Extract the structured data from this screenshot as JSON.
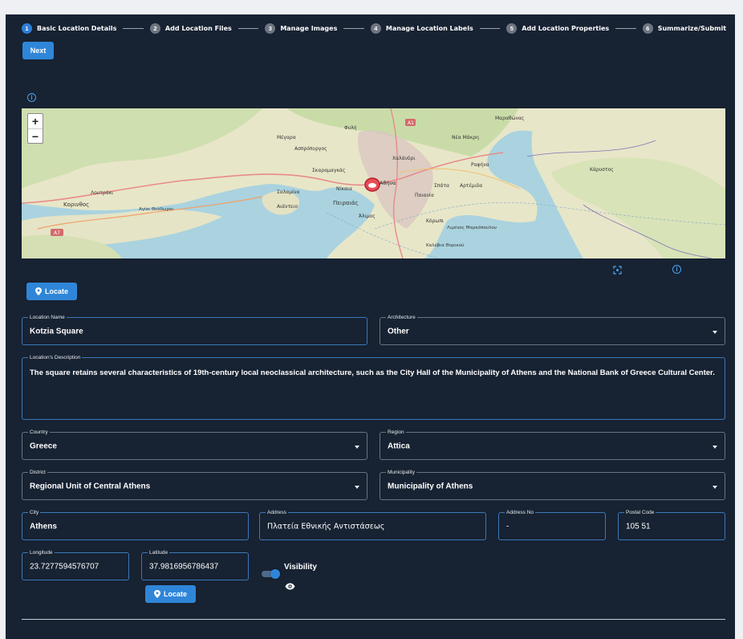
{
  "stepper": {
    "steps": [
      {
        "num": "1",
        "label": "Basic Location Details"
      },
      {
        "num": "2",
        "label": "Add Location Files"
      },
      {
        "num": "3",
        "label": "Manage Images"
      },
      {
        "num": "4",
        "label": "Manage Location Labels"
      },
      {
        "num": "5",
        "label": "Add Location Properties"
      },
      {
        "num": "6",
        "label": "Summarize/Submit"
      }
    ]
  },
  "next_button": "Next",
  "map": {
    "zoom_in": "+",
    "zoom_out": "−",
    "labels": [
      {
        "text": "Μέγαρα"
      },
      {
        "text": "Ασπρόπυργος"
      },
      {
        "text": "Φυλή"
      },
      {
        "text": "Αθήνα"
      },
      {
        "text": "Μαραθώνας"
      },
      {
        "text": "Νέα Μάκρη"
      },
      {
        "text": "Χαλάνδρι"
      },
      {
        "text": "Ραφήνα"
      },
      {
        "text": "Σκαραμαγκάς"
      },
      {
        "text": "Σαλαμίνα"
      },
      {
        "text": "Νίκαια"
      },
      {
        "text": "Πειραιάς"
      },
      {
        "text": "Αιάντειο"
      },
      {
        "text": "Άλιμος"
      },
      {
        "text": "Παιανία"
      },
      {
        "text": "Σπάτα"
      },
      {
        "text": "Αρτέμιδα"
      },
      {
        "text": "Κόρωπι"
      },
      {
        "text": "Κορινθος"
      },
      {
        "text": "Λουτράκι"
      },
      {
        "text": "Κάρυστος"
      },
      {
        "text": "Αγίοι Θεόδωροι"
      },
      {
        "text": "Λιμένας Μαρκόπουλου"
      },
      {
        "text": "Καλύβια Θορικού"
      },
      {
        "text": "A7"
      },
      {
        "text": "A1"
      }
    ]
  },
  "locate_button": "Locate",
  "fields": {
    "location_name": {
      "label": "Location Name",
      "value": "Kotzia Square"
    },
    "architecture": {
      "label": "Architecture",
      "value": "Other"
    },
    "description": {
      "label": "Location's Description",
      "value": "The square retains several characteristics of 19th-century local neoclassical architecture, such as the City Hall of the Municipality of Athens and the National Bank of Greece Cultural Center."
    },
    "country": {
      "label": "Country",
      "value": "Greece"
    },
    "region": {
      "label": "Region",
      "value": "Attica"
    },
    "district": {
      "label": "District",
      "value": "Regional Unit of Central Athens"
    },
    "municipality": {
      "label": "Municipality",
      "value": "Municipality of Athens"
    },
    "city": {
      "label": "City",
      "value": "Athens"
    },
    "address": {
      "label": "Address",
      "value": "Πλατεία Εθνικής Αντιστάσεως"
    },
    "address_no": {
      "label": "Address No",
      "value": "-"
    },
    "postal_code": {
      "label": "Postal Code",
      "value": "105 51"
    },
    "longitude": {
      "label": "Longitude",
      "value": "23.7277594576707"
    },
    "latitude": {
      "label": "Latitude",
      "value": "37.9816956786437"
    }
  },
  "visibility": {
    "label": "Visibility",
    "on": true
  },
  "colors": {
    "panel": "#172232",
    "accent": "#2f86d8",
    "field_border": "#3b78b9"
  }
}
